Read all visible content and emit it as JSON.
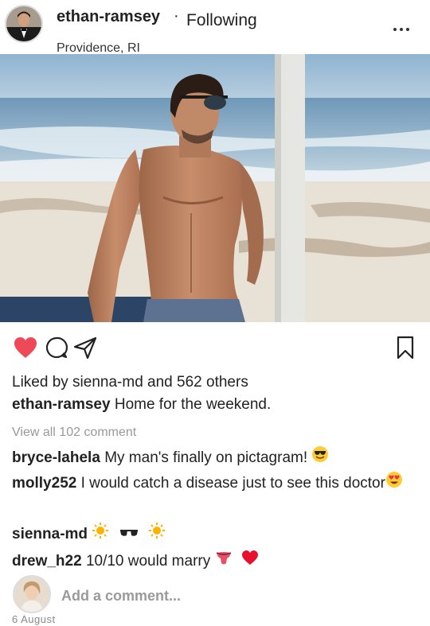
{
  "post": {
    "username": "ethan-ramsey",
    "separator": "·",
    "follow_status": "Following",
    "location": "Providence, RI",
    "more_icon": "ellipsis-icon"
  },
  "image": {
    "description_icon": "beach-photo"
  },
  "actions": {
    "like_icon": "heart-filled-icon",
    "comment_icon": "comment-bubble-icon",
    "share_icon": "paper-plane-icon",
    "save_icon": "bookmark-icon",
    "like_color": "#ed4956"
  },
  "likes": {
    "prefix": "Liked by ",
    "liker": "sienna-md",
    "middle": " and ",
    "count_text": "562 others"
  },
  "caption": {
    "username": "ethan-ramsey",
    "text": "Home for the weekend."
  },
  "view_all": "View all 102 comment",
  "comments": [
    {
      "username": "bryce-lahela",
      "text": "My man's finally on pictagram!",
      "emoji": "sunglasses-smile"
    },
    {
      "username": "molly252",
      "text": "I would catch a disease just to see this doctor",
      "emoji": "heart-eyes"
    },
    {
      "username": "sienna-md",
      "text": "",
      "emoji": "sun-sunglasses-sun"
    },
    {
      "username": "drew_h22",
      "text": "10/10 would marry",
      "emoji": "tongue-heart"
    }
  ],
  "add_comment": {
    "placeholder": "Add a comment..."
  },
  "date": "6 August"
}
